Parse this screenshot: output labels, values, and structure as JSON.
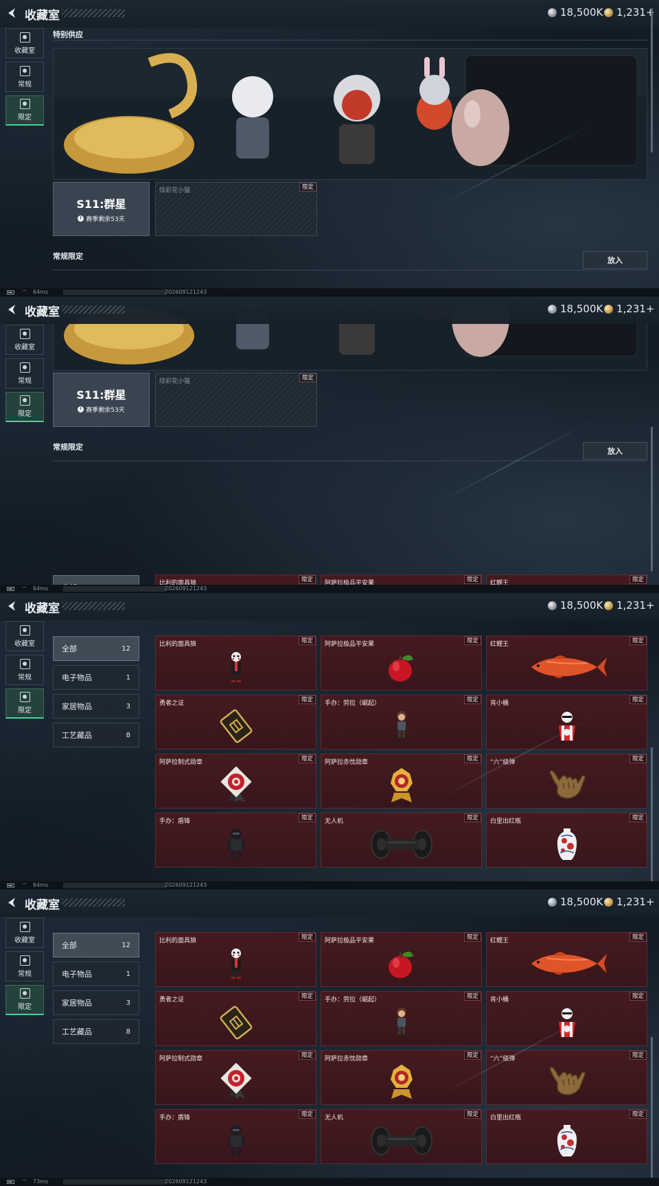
{
  "header": {
    "title": "收藏室",
    "silver_amount": "18,500K",
    "gold_amount": "1,231+"
  },
  "sidebar": [
    {
      "label": "收藏室",
      "icon": "collection-icon"
    },
    {
      "label": "常规",
      "icon": "regular-icon"
    },
    {
      "label": "限定",
      "icon": "limited-icon",
      "active": true
    }
  ],
  "special_supply": {
    "title": "特别供应",
    "banner_desc": "promo banner with golden dragon-turtle statue, armored chibi figure, red-hooded chibi figure, bunny-eared figure in egg, pearl egg",
    "season": {
      "name": "S11:群星",
      "remaining": "赛季剩余53天"
    },
    "card": {
      "name": "炫彩花小猫",
      "tag": "限定"
    }
  },
  "regular_limited": {
    "title": "常规限定",
    "put_button": "放入",
    "categories": [
      {
        "label": "全部",
        "count": "12"
      },
      {
        "label": "电子物品",
        "count": "1"
      },
      {
        "label": "家居物品",
        "count": "3"
      },
      {
        "label": "工艺藏品",
        "count": "8"
      }
    ],
    "items": [
      {
        "name": "比利的面具狼",
        "tag": "限定",
        "icon": "jigsaw-puppet-icon"
      },
      {
        "name": "阿萨拉极品平安果",
        "tag": "限定",
        "icon": "apple-icon"
      },
      {
        "name": "红鲤王",
        "tag": "限定",
        "icon": "koi-fish-icon"
      },
      {
        "name": "勇者之证",
        "tag": "限定",
        "icon": "golden-card-icon"
      },
      {
        "name": "手办：劳拉（崛起）",
        "tag": "限定",
        "icon": "lara-figure-icon"
      },
      {
        "name": "肯小桶",
        "tag": "限定",
        "icon": "bucket-figure-icon"
      },
      {
        "name": "阿萨拉制式勋章",
        "tag": "限定",
        "icon": "red-medal-icon"
      },
      {
        "name": "阿萨拉赤忱勋章",
        "tag": "限定",
        "icon": "gold-medal-icon"
      },
      {
        "name": "“六”级弹",
        "tag": "限定",
        "icon": "shaka-hand-icon"
      },
      {
        "name": "手办：盾锋",
        "tag": "限定",
        "icon": "armored-figure-icon"
      },
      {
        "name": "无人机",
        "tag": "限定",
        "icon": "drone-icon"
      },
      {
        "name": "白里出红瓶",
        "tag": "限定",
        "icon": "vase-icon"
      }
    ]
  },
  "status_bars": [
    {
      "ping": "64ms",
      "build": "202609121243"
    },
    {
      "ping": "64ms",
      "build": "202609121243"
    },
    {
      "ping": "64ms",
      "build": "202609121243"
    },
    {
      "ping": "73ms",
      "build": "202609121243"
    }
  ],
  "colors": {
    "accent_green": "#4ad19a",
    "item_bg": "#451a1f",
    "panel_bg": "#121b24"
  }
}
